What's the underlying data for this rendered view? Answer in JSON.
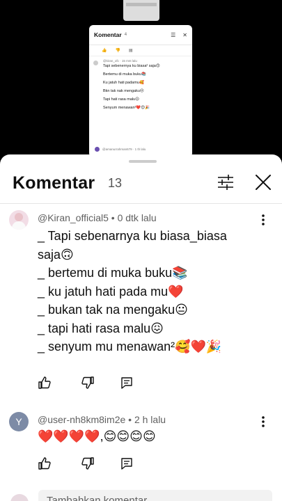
{
  "thumbnail": {
    "title": "Komentar",
    "count": "4",
    "user": "@kiran_ofc · 15 mnt lalu",
    "lines": [
      "Tapi sebenernya ku biasa² saja🙃",
      "Bertemu di muka buku📚",
      "Ku jatuh hati padamu🥰",
      "Bkn tak nak mengaku😐",
      "Tapi hati rasa malu😖",
      "Senyum menawan²❤️😊🎉"
    ],
    "next_user": "@amanurrahman679 · 1 th lalu"
  },
  "sheet": {
    "title": "Komentar",
    "count": "13",
    "filter_icon": "filter-sliders-icon",
    "close_icon": "close-icon"
  },
  "comments": [
    {
      "author_meta": "@Kiran_official5 • 0 dtk lalu",
      "lines": [
        "_ Tapi sebenarnya ku biasa_biasa",
        "saja🙃",
        "_ bertemu di muka buku📚",
        "_ ku jatuh hati pada mu❤️",
        "_ bukan tak na mengaku😐",
        "_ tapi hati rasa malu😖",
        "_ senyum mu menawan²🥰❤️🎉"
      ]
    },
    {
      "avatar_letter": "Y",
      "author_meta": "@user-nh8km8im2e • 2 h lalu",
      "lines": [
        "❤️❤️❤️❤️,😊😊😊😊"
      ]
    }
  ],
  "reply": {
    "placeholder": "Tambahkan komentar..."
  },
  "colors": {
    "text": "#0f0f0f",
    "muted": "#606060",
    "avatar_y": "#7d8ba6"
  }
}
